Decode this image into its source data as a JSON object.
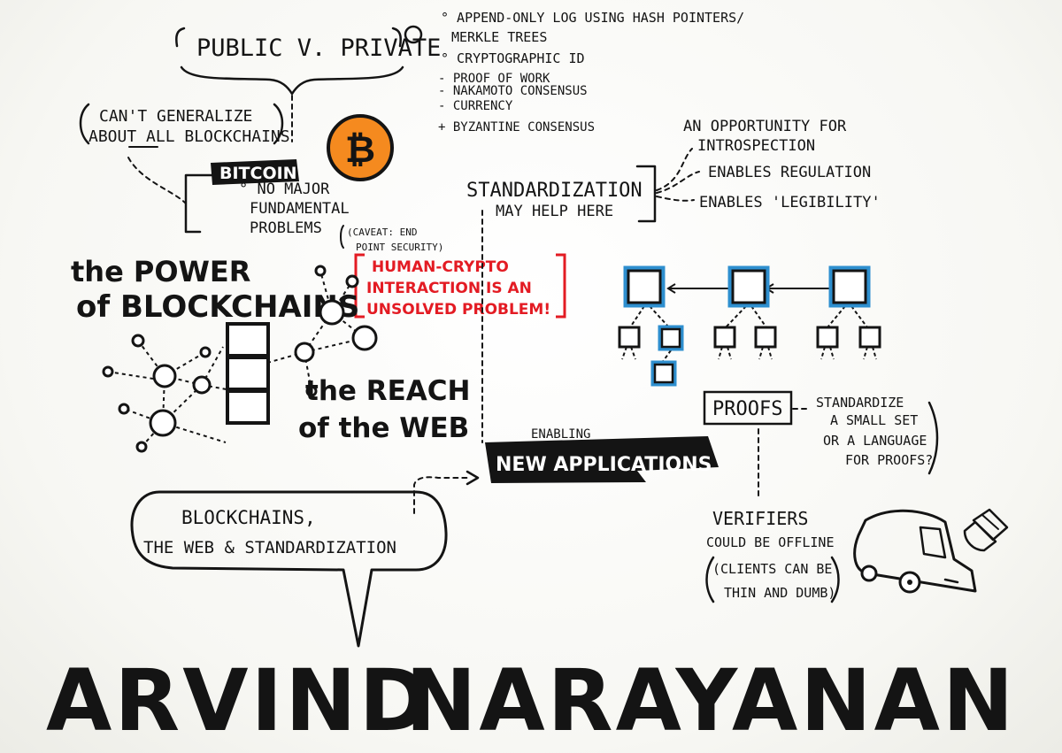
{
  "header": {
    "public_private": "PUBLIC v. PRIVATE",
    "cant_generalize": [
      "CAN'T GENERALIZE",
      "ABOUT ALL BLOCKCHAINS"
    ]
  },
  "features": [
    "° APPEND-ONLY LOG USING HASH POINTERS/",
    "MERKLE TREES",
    "° CRYPTOGRAPHIC ID",
    "- PROOF of WORK",
    "- NAKAMOTO CONSENSUS",
    "- CURRENCY",
    "+ BYZANTINE CONSENSUS"
  ],
  "bitcoin": {
    "label": "BITCOIN",
    "notes": [
      "° NO MAJOR",
      "FUNDAMENTAL",
      "PROBLEMS"
    ],
    "caveat": [
      "(CAVEAT: END",
      "POINT SECURITY)"
    ],
    "coin_symbol": "₿"
  },
  "human_crypto": [
    "HUMAN-CRYPTO",
    "INTERACTION is an",
    "UNSOLVED PROBLEM!"
  ],
  "power": [
    "the POWER",
    "of BLOCKCHAINS"
  ],
  "reach": [
    "the REACH",
    "of the WEB"
  ],
  "standardization": {
    "title": "STANDARDIZATION",
    "subtitle": "MAY HELP HERE",
    "benefits": [
      "AN OPPORTUNITY for",
      "INTROSPECTION",
      "ENABLES REGULATION",
      "ENABLES 'LEGIBILITY'"
    ]
  },
  "proofs": {
    "label": "PROOFS",
    "note": [
      "STANDARDIZE",
      "a SMALL SET",
      "OR a LANGUAGE",
      "for PROOFS?"
    ]
  },
  "verifiers": [
    "VERIFIERS",
    "COULD BE OFFLINE",
    "(CLIENTS CAN BE",
    "THIN and DUMB)"
  ],
  "enabling": {
    "small": "ENABLING",
    "banner": "NEW APPLICATIONS"
  },
  "speech": [
    "BLOCKCHAINS,",
    "the WEB & STANDARDIZATION"
  ],
  "speaker": {
    "first": "ARVIND",
    "last": "NARAYANAN"
  },
  "colors": {
    "ink": "#141414",
    "accent_red": "#e31b23",
    "coin_orange": "#f58a1f",
    "chain_blue": "#2e8fcf"
  }
}
